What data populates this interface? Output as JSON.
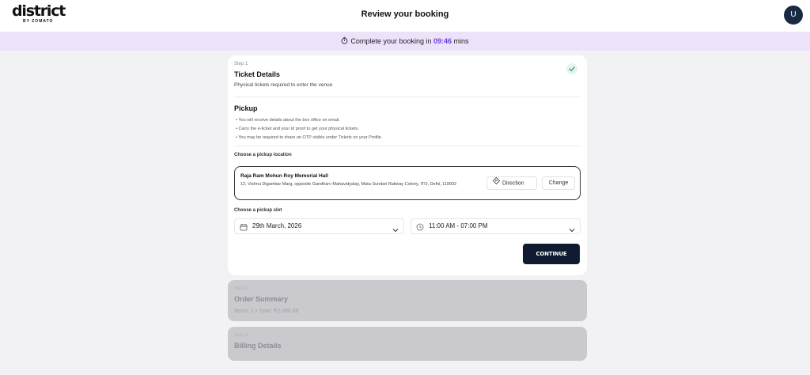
{
  "header": {
    "logo_main": "district",
    "logo_sub": "BY ZOMATO",
    "title": "Review your booking",
    "avatar_initial": "U"
  },
  "timer": {
    "prefix": "Complete your booking in",
    "time": "09:46",
    "suffix": "mins"
  },
  "step1": {
    "step_label": "Step 1",
    "title": "Ticket Details",
    "description": "Physical tickets required to enter the venue",
    "completed": true
  },
  "pickup": {
    "title": "Pickup",
    "bullets": [
      "You will receive details about the box office on email.",
      "Carry the e-ticket and your id proof to get your physical tickets.",
      "You may be required to share an OTP visible under Tickets on your Profile."
    ],
    "location_label": "Choose a pickup location",
    "location_name": "Raja Ram Mohun Roy Memorial Hall",
    "location_address": "12, Vishnu Digambar Marg, opposite Gandharv Mahavidyalay, Mata Sundari Railway Colony, ITO, Delhi, 110002",
    "direction_label": "Direction",
    "change_label": "Change",
    "slot_label": "Choose a pickup slot",
    "date_value": "29th March, 2026",
    "time_value": "11:00 AM - 07:00 PM",
    "continue_label": "CONTINUE"
  },
  "step2": {
    "step_label": "Step 2",
    "title": "Order Summary",
    "description": "Items: 1 • Total: ₹2,090.58"
  },
  "step3": {
    "step_label": "Step 3",
    "title": "Billing Details"
  },
  "colors": {
    "timer_bg": "#ece3fb",
    "timer_accent": "#6b3fd6",
    "primary_button": "#0f1b30",
    "avatar_bg": "#1b2a44",
    "check_green": "#1f9d6b"
  }
}
